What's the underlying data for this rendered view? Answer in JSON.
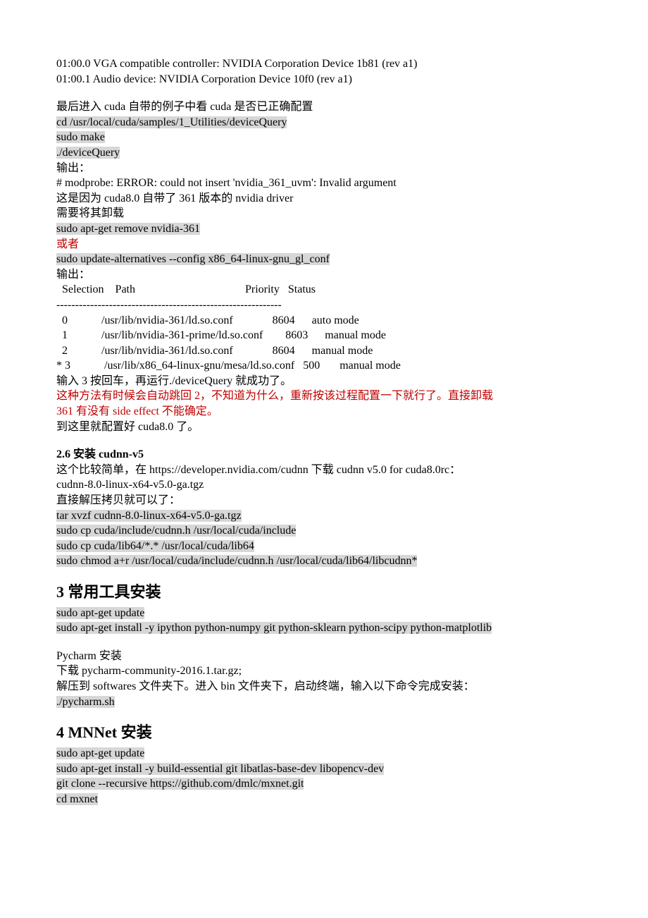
{
  "intro": {
    "line1": "01:00.0 VGA compatible controller: NVIDIA Corporation Device 1b81 (rev a1)",
    "line2": "01:00.1 Audio device: NVIDIA Corporation Device 10f0 (rev a1)"
  },
  "cuda": {
    "note1": "最后进入 cuda 自带的例子中看 cuda 是否已正确配置",
    "cmd1": "cd /usr/local/cuda/samples/1_Utilities/deviceQuery",
    "cmd2": "sudo make",
    "cmd3": "./deviceQuery",
    "out_label": "输出：",
    "out1": "# modprobe: ERROR: could not insert 'nvidia_361_uvm': Invalid argument",
    "reason1": "这是因为 cuda8.0 自带了 361 版本的 nvidia driver",
    "reason2": "需要将其卸载",
    "cmd4": "sudo apt-get remove nvidia-361",
    "or": "或者",
    "cmd5": "sudo update-alternatives --config x86_64-linux-gnu_gl_conf",
    "out_label2": "输出：",
    "table_header": "  Selection    Path                                       Priority   Status",
    "table_sep": "------------------------------------------------------------",
    "table_row0": "  0            /usr/lib/nvidia-361/ld.so.conf              8604      auto mode",
    "table_row1": "  1            /usr/lib/nvidia-361-prime/ld.so.conf        8603      manual mode",
    "table_row2": "  2            /usr/lib/nvidia-361/ld.so.conf              8604      manual mode",
    "table_row3": "* 3            /usr/lib/x86_64-linux-gnu/mesa/ld.so.conf   500       manual mode",
    "after1": "输入 3 按回车，再运行./deviceQuery 就成功了。",
    "warn1": "这种方法有时候会自动跳回 2，不知道为什么，重新按该过程配置一下就行了。直接卸载",
    "warn2": "361 有没有 side effect 不能确定。",
    "done": "到这里就配置好 cuda8.0 了。"
  },
  "cudnn": {
    "heading": "2.6 安装 cudnn-v5",
    "l1": "这个比较简单，在 https://developer.nvidia.com/cudnn 下载 cudnn v5.0 for cuda8.0rc：",
    "l2": "cudnn-8.0-linux-x64-v5.0-ga.tgz",
    "l3": "直接解压拷贝就可以了：",
    "cmd1": "tar xvzf cudnn-8.0-linux-x64-v5.0-ga.tgz",
    "cmd2": "sudo cp cuda/include/cudnn.h /usr/local/cuda/include",
    "cmd3": "sudo cp cuda/lib64/*.* /usr/local/cuda/lib64",
    "cmd4": "sudo chmod a+r /usr/local/cuda/include/cudnn.h /usr/local/cuda/lib64/libcudnn*"
  },
  "tools": {
    "heading": "3 常用工具安装",
    "cmd1": "sudo apt-get update",
    "cmd2": "sudo apt-get install -y ipython python-numpy git python-sklearn python-scipy python-matplotlib",
    "pycharm_h": "Pycharm 安装",
    "pycharm_l1": "下载 pycharm-community-2016.1.tar.gz;",
    "pycharm_l2": "解压到 softwares 文件夹下。进入 bin 文件夹下，启动终端，输入以下命令完成安装：",
    "pycharm_cmd": "./pycharm.sh"
  },
  "mxnet": {
    "heading": "4 MNNet 安装",
    "cmd1": "sudo apt-get update",
    "cmd2": "sudo apt-get install -y build-essential git libatlas-base-dev libopencv-dev",
    "cmd3": "git clone --recursive https://github.com/dmlc/mxnet.git",
    "cmd4": "cd mxnet"
  }
}
